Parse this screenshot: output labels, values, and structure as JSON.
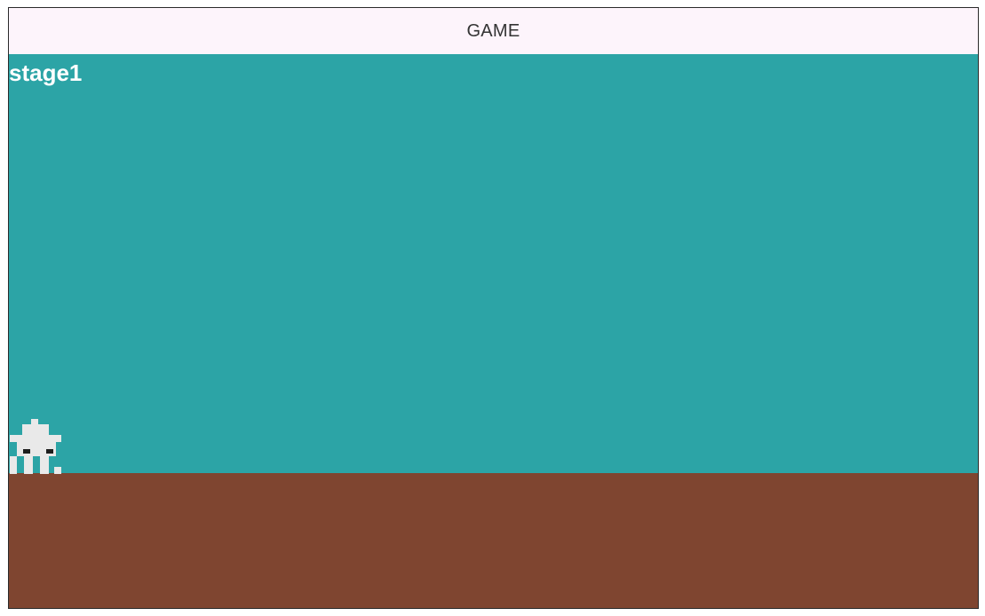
{
  "window": {
    "title": "GAME"
  },
  "hud": {
    "stage_label": "stage1"
  },
  "scene": {
    "sky_color": "#2ca4a6",
    "ground_color": "#7f4530",
    "player_color": "#e9e9e9",
    "player_eye_color": "#1e1e1e",
    "player_icon": "pixel-creature-icon"
  }
}
